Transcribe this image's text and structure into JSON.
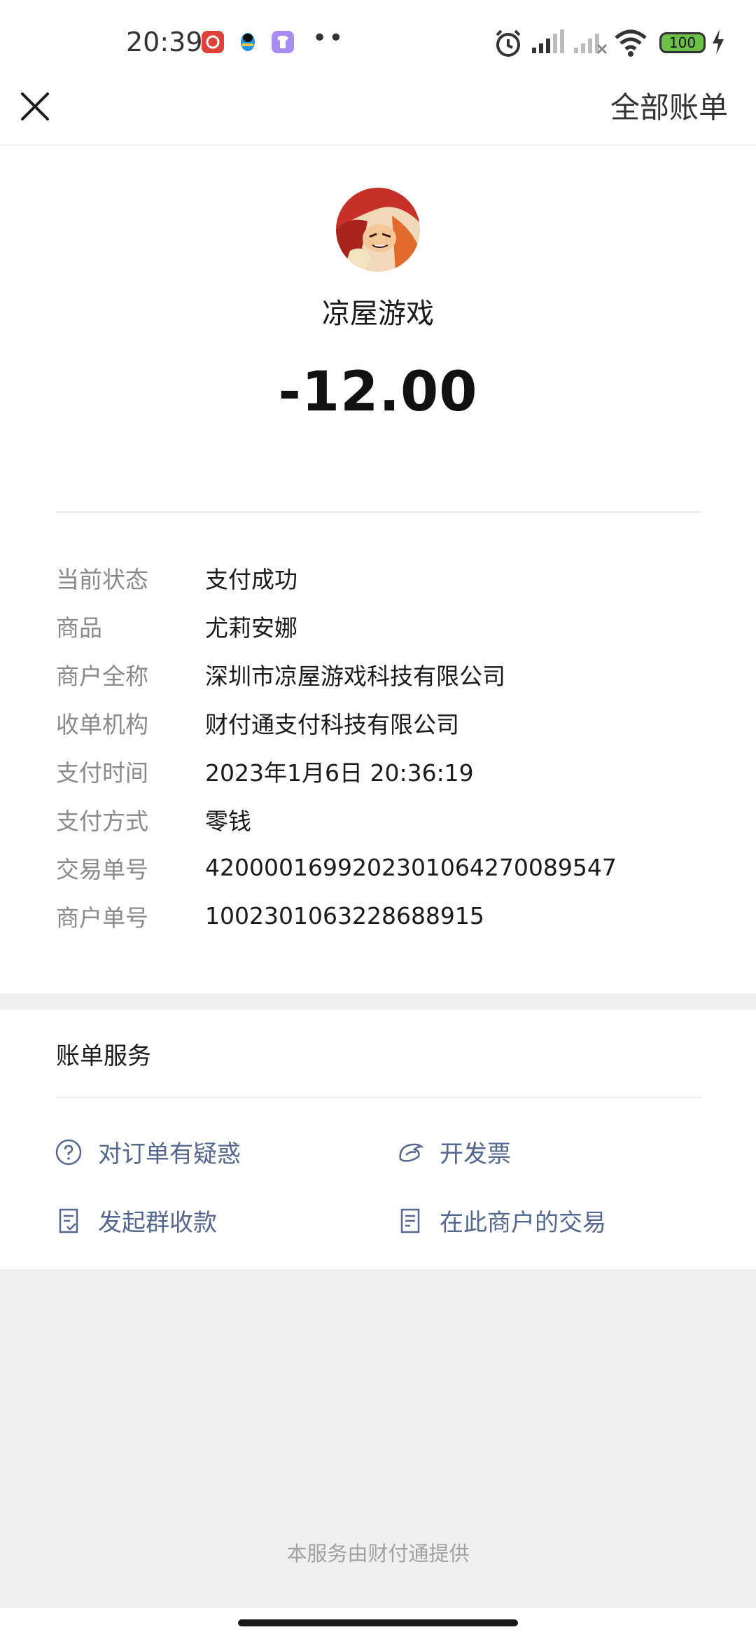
{
  "status_bar": {
    "time": "20:39",
    "battery": "100",
    "icons": [
      "netease-music-icon",
      "qq-icon",
      "theme-icon",
      "alarm-icon",
      "signal-icon",
      "signal-off-icon",
      "wifi-icon",
      "battery-icon",
      "charging-icon"
    ]
  },
  "nav": {
    "close_icon": "close-icon",
    "all_bills": "全部账单"
  },
  "merchant": {
    "name": "凉屋游戏",
    "amount": "-12.00"
  },
  "details": [
    {
      "label": "当前状态",
      "value": "支付成功"
    },
    {
      "label": "商品",
      "value": "尤莉安娜"
    },
    {
      "label": "商户全称",
      "value": "深圳市凉屋游戏科技有限公司"
    },
    {
      "label": "收单机构",
      "value": "财付通支付科技有限公司"
    },
    {
      "label": "支付时间",
      "value": "2023年1月6日 20:36:19"
    },
    {
      "label": "支付方式",
      "value": "零钱"
    },
    {
      "label": "交易单号",
      "value": "4200001699202301064270089547"
    },
    {
      "label": "商户单号",
      "value": "1002301063228688915"
    }
  ],
  "services": {
    "title": "账单服务",
    "items": [
      {
        "label": "对订单有疑惑",
        "icon": "question-circle-icon"
      },
      {
        "label": "开发票",
        "icon": "invoice-icon"
      },
      {
        "label": "发起群收款",
        "icon": "group-collect-icon"
      },
      {
        "label": "在此商户的交易",
        "icon": "transactions-list-icon"
      }
    ]
  },
  "footer": {
    "text": "本服务由财付通提供"
  },
  "colors": {
    "link": "#55678f",
    "label": "#8a8a8a",
    "battery": "#6cc04a"
  }
}
